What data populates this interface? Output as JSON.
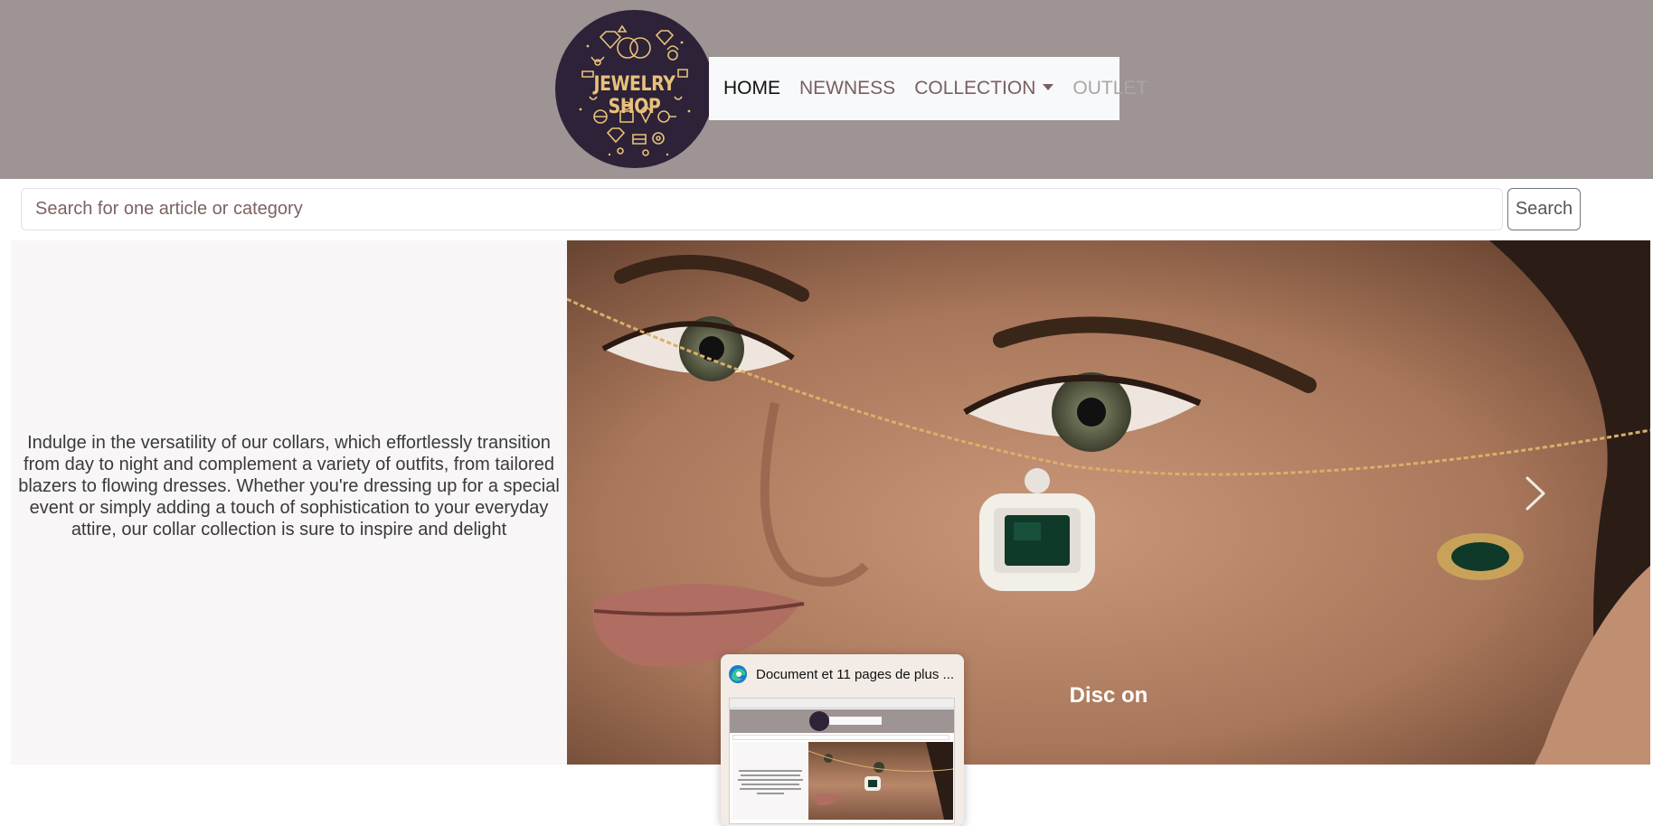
{
  "brand": {
    "logo_text": "JEWELRY SHOP"
  },
  "nav": {
    "home": "HOME",
    "newness": "NEWNESS",
    "collection": "COLLECTION",
    "outlet": "OUTLET"
  },
  "search": {
    "placeholder": "Search for one article or category",
    "button_label": "Search"
  },
  "carousel": {
    "description": "Indulge in the versatility of our collars, which effortlessly transition from day to night and complement a variety of outfits, from tailored blazers to flowing dresses. Whether you're dressing up for a special event or simply adding a touch of sophistication to your everyday attire, our collar collection is sure to inspire and delight",
    "caption_visible": "Disc                                    on"
  },
  "taskbar_thumbnail": {
    "title": "Document et 11 pages de plus ..."
  },
  "colors": {
    "header_bg": "#9e9494",
    "logo_bg": "#2d2238",
    "logo_gold": "#e8c27a",
    "nav_bg": "#f8f9fa",
    "left_panel_bg": "#f8f6f6"
  }
}
